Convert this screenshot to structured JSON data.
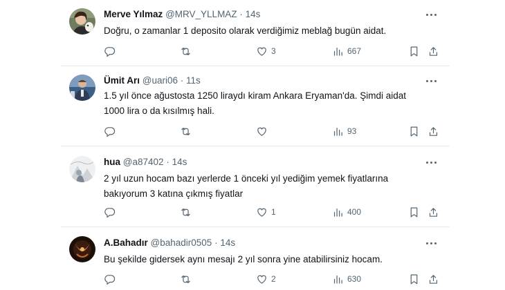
{
  "tweets": [
    {
      "name": "Merve Yılmaz",
      "handle": "@MRV_YLLMAZ",
      "sep": "·",
      "time": "14s",
      "lines": [
        "Doğru, o zamanlar 1 deposito olarak verdiğimiz meblağ bugün aidat."
      ],
      "replies": "",
      "retweets": "",
      "likes": "3",
      "views": "667"
    },
    {
      "name": "Ümit Arı",
      "handle": "@uari06",
      "sep": "·",
      "time": "11s",
      "lines": [
        "1.5 yıl önce ağustosta 1250 liraydı kiram Ankara Eryaman'da. Şimdi aidat",
        "1000 lira o da kısılmış hali."
      ],
      "replies": "",
      "retweets": "",
      "likes": "",
      "views": "93"
    },
    {
      "name": "hua",
      "handle": "@a87402",
      "sep": "·",
      "time": "14s",
      "lines": [
        "2 yıl uzun hocam bazı yerlerde 1 önceki yıl yediğim yemek fiyatlarına",
        "bakıyorum 3 katına çıkmış fiyatlar"
      ],
      "replies": "",
      "retweets": "",
      "likes": "1",
      "views": "400"
    },
    {
      "name": "A.Bahadır",
      "handle": "@bahadir0505",
      "sep": "·",
      "time": "14s",
      "lines": [
        "Bu şekilde gidersek aynı mesajı 2 yıl sonra yine atabilirsiniz hocam."
      ],
      "replies": "",
      "retweets": "",
      "likes": "2",
      "views": "630"
    }
  ],
  "icons": {
    "reply": "reply-icon",
    "retweet": "retweet-icon",
    "like": "heart-icon",
    "views": "views-icon",
    "bookmark": "bookmark-icon",
    "share": "share-icon",
    "more": "more-icon"
  },
  "colors": {
    "text": "#0f1419",
    "muted": "#536471",
    "divider": "#e7e9ea"
  }
}
